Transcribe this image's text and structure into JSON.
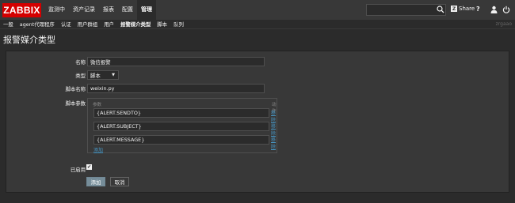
{
  "brand": {
    "logo": "ZABBIX",
    "accent": "#d40000"
  },
  "top_nav": {
    "items": [
      "监测中",
      "资产记录",
      "报表",
      "配置",
      "管理"
    ],
    "active_index": 4,
    "search_placeholder": "",
    "share_label": "Share",
    "help_label": "?"
  },
  "sub_nav": {
    "items": [
      "一般",
      "agent代理程序",
      "认证",
      "用户群组",
      "用户",
      "报警媒介类型",
      "脚本",
      "队列"
    ],
    "active_index": 5,
    "right_text": "zrgaao"
  },
  "page": {
    "title": "报警媒介类型"
  },
  "form": {
    "name_label": "名称",
    "name_value": "微信报警",
    "type_label": "类型",
    "type_value": "脚本",
    "script_name_label": "脚本名称",
    "script_name_value": "weixin.py",
    "params_label": "脚本参数",
    "params_header_param": "参数",
    "params_header_action": "动作",
    "params": [
      {
        "value": "{ALERT.SENDTO}",
        "remove": "移除"
      },
      {
        "value": "{ALERT.SUBJECT}",
        "remove": "移除"
      },
      {
        "value": "{ALERT.MESSAGE}",
        "remove": "移除"
      }
    ],
    "add_param": "添加",
    "enabled_label": "已启用",
    "enabled": true,
    "submit_label": "添加",
    "cancel_label": "取消"
  }
}
